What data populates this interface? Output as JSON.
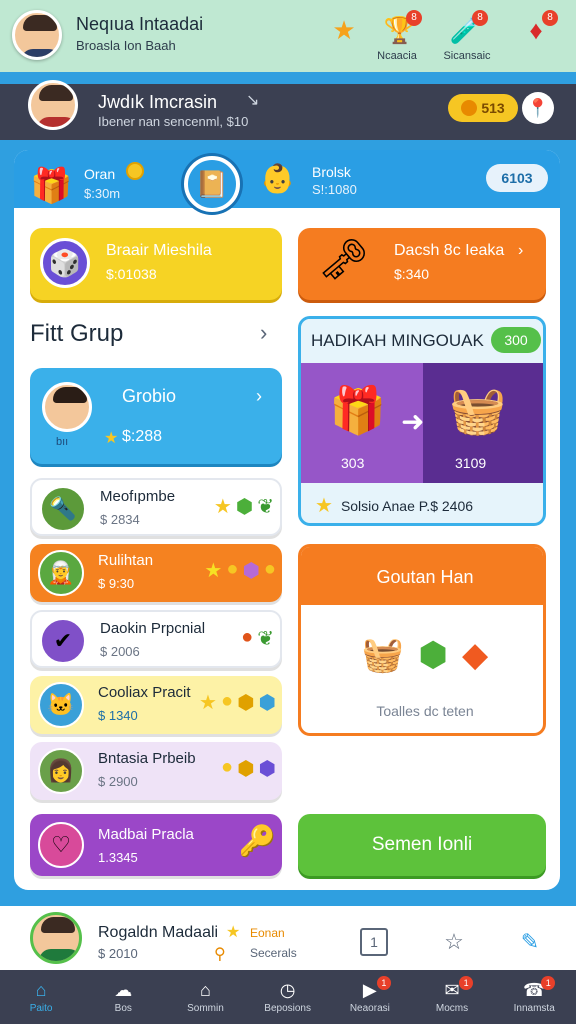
{
  "header": {
    "name": "Neqıua Intaadai",
    "subtitle": "Broasla Ion Baah",
    "icons": [
      {
        "icon": "star-icon",
        "label": ""
      },
      {
        "icon": "trophy-icon",
        "label": "Ncaacia",
        "badge": "8"
      },
      {
        "icon": "potion-icon",
        "label": "Sicansaic",
        "badge": "8"
      },
      {
        "icon": "gem-icon",
        "label": "",
        "badge": "8"
      }
    ]
  },
  "profile": {
    "name": "Jwdık Imcrasin",
    "subtitle": "Ibener nan sencenml, $10",
    "coins": "513",
    "pin_icon": "location-pin-icon"
  },
  "panel": {
    "left_label": "Oran",
    "left_value": "$:30m",
    "right_label": "Brolsk",
    "right_value": "S!:1080",
    "pill": "6103"
  },
  "cards": {
    "yellow_title": "Braair Mieshila",
    "yellow_sub": "$:01038",
    "orange_title": "Dacsh 8c Ieaka",
    "orange_sub": "$:340"
  },
  "group": {
    "title": "Fitt Grup",
    "featured_title": "Grobio",
    "featured_tag": "bıı",
    "featured_value": "$:288"
  },
  "list": [
    {
      "title": "Meofıpmbe",
      "sub": "$ 2834"
    },
    {
      "title": "Rulihtan",
      "sub": "$ 9:30"
    },
    {
      "title": "Daokin Prpcnial",
      "sub": "$ 2006"
    },
    {
      "title": "Cooliax Pracit",
      "sub": "$ 1340"
    },
    {
      "title": "Bntasia Prbeib",
      "sub": "$ 2900"
    },
    {
      "title": "Madbai Pracla",
      "sub": "1.3345"
    }
  ],
  "trade": {
    "title": "HADIKAH MINGOUAK",
    "pill": "300",
    "value_left": "303",
    "value_right": "3109",
    "footer": "Solsio Anae P.$ 2406"
  },
  "summary": {
    "title": "Goutan Han",
    "footer": "Toalles dc teten"
  },
  "action_button": "Semen Ionli",
  "user_strip": {
    "name": "Rogaldn Madaali",
    "sub": "$ 2010",
    "label1": "Eonan",
    "label2": "Secerals"
  },
  "nav": [
    {
      "label": "Paito",
      "icon": "home-icon",
      "active": true
    },
    {
      "label": "Bos",
      "icon": "chat-icon"
    },
    {
      "label": "Sommin",
      "icon": "house-icon"
    },
    {
      "label": "Beposions",
      "icon": "clock-icon"
    },
    {
      "label": "Neaorasi",
      "icon": "play-icon",
      "badge": "1"
    },
    {
      "label": "Mocms",
      "icon": "inbox-icon",
      "badge": "1"
    },
    {
      "label": "Innamsta",
      "icon": "bag-icon",
      "badge": "1"
    }
  ]
}
